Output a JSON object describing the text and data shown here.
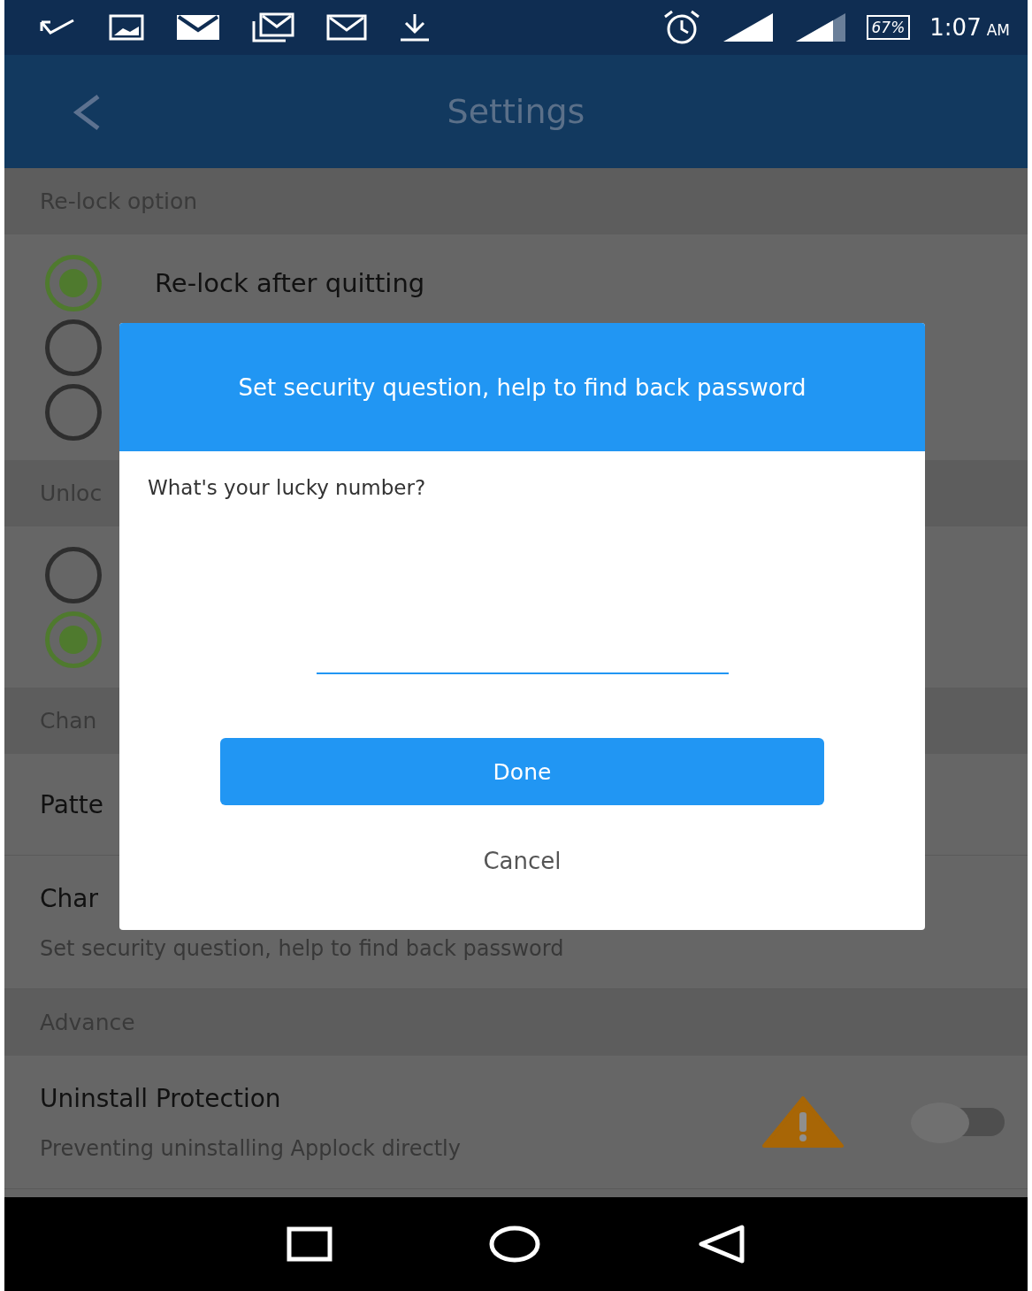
{
  "status_bar": {
    "battery": "67%",
    "time": "1:07",
    "ampm": "AM"
  },
  "app_bar": {
    "title": "Settings"
  },
  "sections": [
    {
      "header": "Re-lock option",
      "kind": "radio",
      "options": [
        {
          "label": "Re-lock after quitting",
          "selected": true
        },
        {
          "selected": false
        },
        {
          "selected": false
        }
      ]
    },
    {
      "header": "Unloc",
      "kind": "radio",
      "options": [
        {
          "selected": false
        },
        {
          "selected": true
        }
      ]
    },
    {
      "header": "Chan",
      "kind": "item",
      "items": [
        {
          "title": "Patte"
        },
        {
          "title": "Char",
          "subtitle": "Set security question, help to find back password"
        }
      ]
    },
    {
      "header": "Advance",
      "kind": "item",
      "items": [
        {
          "title": "Uninstall Protection",
          "subtitle": "Preventing uninstalling Applock directly",
          "warning": true,
          "toggle_on": false
        }
      ]
    }
  ],
  "dialog": {
    "title": "Set security question, help to find back password",
    "question": "What's your lucky number?",
    "buttons": [
      {
        "label": "Done",
        "kind": "primary"
      },
      {
        "label": "Cancel",
        "kind": "text"
      }
    ]
  }
}
